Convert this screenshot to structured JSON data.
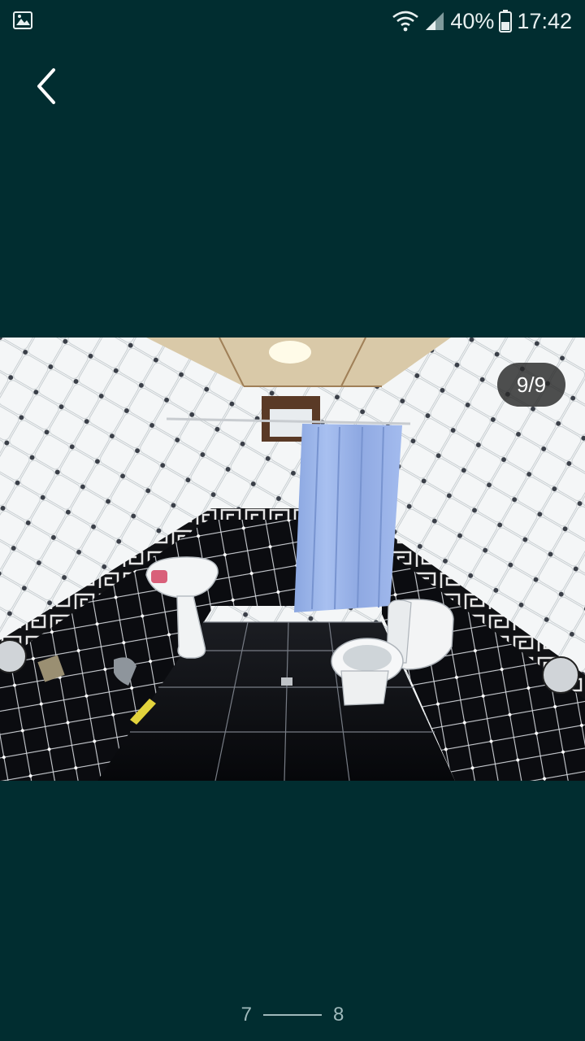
{
  "status_bar": {
    "battery": "40%",
    "time": "17:42"
  },
  "viewer": {
    "counter": "9/9"
  },
  "pager": {
    "prev": "7",
    "next": "8"
  },
  "colors": {
    "background": "#012d30",
    "badge": "#282828"
  },
  "icons": {
    "status_left": "gallery-icon",
    "back": "chevron-left-icon"
  }
}
